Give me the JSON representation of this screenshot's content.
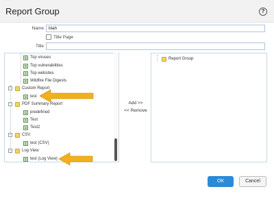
{
  "dialog": {
    "title": "Report Group",
    "help_icon": "help-circle-icon"
  },
  "form": {
    "name_label": "Name",
    "name_value": "blah",
    "title_page_label": "Title Page",
    "title_page_checked": false,
    "title_label": "Title",
    "title_value": ""
  },
  "left_tree": {
    "items": [
      {
        "label": "Top viruses",
        "icon": "report-icon"
      },
      {
        "label": "Top vulnerabilities",
        "icon": "report-icon"
      },
      {
        "label": "Top websites",
        "icon": "report-icon"
      },
      {
        "label": "Wildfire File Digests",
        "icon": "report-icon"
      },
      {
        "label": "Custom Report",
        "icon": "folder-icon"
      },
      {
        "label": "test",
        "icon": "report-icon"
      },
      {
        "label": "PDF Summary Report",
        "icon": "folder-icon"
      },
      {
        "label": "predefined",
        "icon": "report-icon"
      },
      {
        "label": "Test",
        "icon": "report-icon"
      },
      {
        "label": "Test2",
        "icon": "report-icon"
      },
      {
        "label": "CSV",
        "icon": "folder-icon"
      },
      {
        "label": "test (CSV)",
        "icon": "report-icon"
      },
      {
        "label": "Log View",
        "icon": "folder-icon"
      },
      {
        "label": "test (Log View)",
        "icon": "report-icon"
      }
    ]
  },
  "actions": {
    "add_label": "Add >>",
    "remove_label": "<< Remove"
  },
  "right_tree": {
    "items": [
      {
        "label": "Report Group",
        "icon": "folder-icon"
      }
    ]
  },
  "footer": {
    "ok_label": "OK",
    "cancel_label": "Cancel"
  },
  "colors": {
    "accent": "#2c8ad6",
    "arrow": "#f2b01e"
  }
}
